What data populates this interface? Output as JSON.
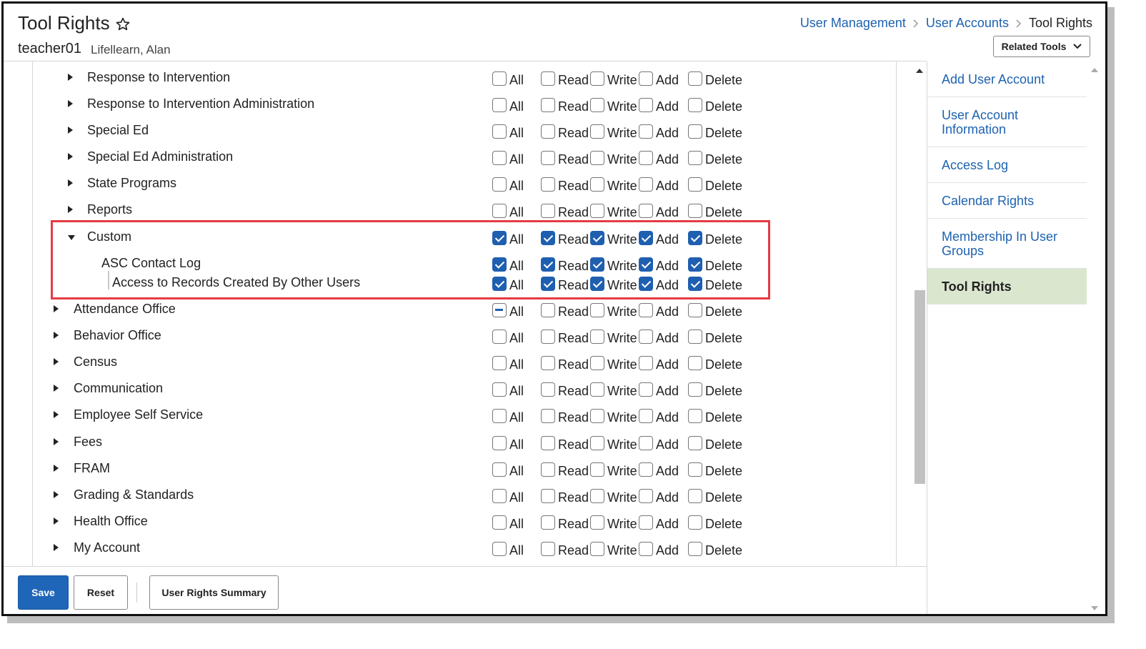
{
  "header": {
    "title": "Tool Rights",
    "favorite_icon": "star-outline-icon",
    "username": "teacher01",
    "person_name": "Lifellearn, Alan"
  },
  "breadcrumb": {
    "items": [
      "User Management",
      "User Accounts"
    ],
    "current": "Tool Rights"
  },
  "related_tools": {
    "label": "Related Tools",
    "icon": "chevron-down-icon"
  },
  "rights_columns": [
    "All",
    "Read",
    "Write",
    "Add",
    "Delete"
  ],
  "tool_rows": [
    {
      "label": "Response to Intervention",
      "level": 1,
      "expander": "collapsed",
      "all": "unchecked",
      "read": false,
      "write": false,
      "add": false,
      "delete": false
    },
    {
      "label": "Response to Intervention Administration",
      "level": 1,
      "expander": "collapsed",
      "all": "unchecked",
      "read": false,
      "write": false,
      "add": false,
      "delete": false
    },
    {
      "label": "Special Ed",
      "level": 1,
      "expander": "collapsed",
      "all": "unchecked",
      "read": false,
      "write": false,
      "add": false,
      "delete": false
    },
    {
      "label": "Special Ed Administration",
      "level": 1,
      "expander": "collapsed",
      "all": "unchecked",
      "read": false,
      "write": false,
      "add": false,
      "delete": false
    },
    {
      "label": "State Programs",
      "level": 1,
      "expander": "collapsed",
      "all": "unchecked",
      "read": false,
      "write": false,
      "add": false,
      "delete": false
    },
    {
      "label": "Reports",
      "level": 1,
      "expander": "collapsed",
      "all": "unchecked",
      "read": false,
      "write": false,
      "add": false,
      "delete": false
    },
    {
      "label": "Custom",
      "level": 1,
      "expander": "expanded",
      "all": "checked",
      "read": true,
      "write": true,
      "add": true,
      "delete": true
    },
    {
      "label": "ASC Contact Log",
      "level": 2,
      "expander": "none",
      "all": "checked",
      "read": true,
      "write": true,
      "add": true,
      "delete": true
    },
    {
      "label": "Access to Records Created By Other Users",
      "level": 3,
      "expander": "none",
      "all": "checked",
      "read": true,
      "write": true,
      "add": true,
      "delete": true
    },
    {
      "label": "Attendance Office",
      "level": 0,
      "expander": "collapsed",
      "all": "indeterminate",
      "read": false,
      "write": false,
      "add": false,
      "delete": false
    },
    {
      "label": "Behavior Office",
      "level": 0,
      "expander": "collapsed",
      "all": "unchecked",
      "read": false,
      "write": false,
      "add": false,
      "delete": false
    },
    {
      "label": "Census",
      "level": 0,
      "expander": "collapsed",
      "all": "unchecked",
      "read": false,
      "write": false,
      "add": false,
      "delete": false
    },
    {
      "label": "Communication",
      "level": 0,
      "expander": "collapsed",
      "all": "unchecked",
      "read": false,
      "write": false,
      "add": false,
      "delete": false
    },
    {
      "label": "Employee Self Service",
      "level": 0,
      "expander": "collapsed",
      "all": "unchecked",
      "read": false,
      "write": false,
      "add": false,
      "delete": false
    },
    {
      "label": "Fees",
      "level": 0,
      "expander": "collapsed",
      "all": "unchecked",
      "read": false,
      "write": false,
      "add": false,
      "delete": false
    },
    {
      "label": "FRAM",
      "level": 0,
      "expander": "collapsed",
      "all": "unchecked",
      "read": false,
      "write": false,
      "add": false,
      "delete": false
    },
    {
      "label": "Grading & Standards",
      "level": 0,
      "expander": "collapsed",
      "all": "unchecked",
      "read": false,
      "write": false,
      "add": false,
      "delete": false
    },
    {
      "label": "Health Office",
      "level": 0,
      "expander": "collapsed",
      "all": "unchecked",
      "read": false,
      "write": false,
      "add": false,
      "delete": false
    },
    {
      "label": "My Account",
      "level": 0,
      "expander": "collapsed",
      "all": "unchecked",
      "read": false,
      "write": false,
      "add": false,
      "delete": false
    }
  ],
  "footer": {
    "save_label": "Save",
    "reset_label": "Reset",
    "summary_label": "User Rights Summary"
  },
  "sidebar": {
    "items": [
      {
        "label": "Add User Account",
        "active": false
      },
      {
        "label": "User Account Information",
        "active": false
      },
      {
        "label": "Access Log",
        "active": false
      },
      {
        "label": "Calendar Rights",
        "active": false
      },
      {
        "label": "Membership In User Groups",
        "active": false
      },
      {
        "label": "Tool Rights",
        "active": true
      }
    ]
  },
  "colors": {
    "link": "#1d62b0",
    "checkbox_checked": "#1f5fb0",
    "save_button": "#1f66b8",
    "highlight_box": "#e53b45",
    "sidebar_active": "#dbe6cf"
  }
}
